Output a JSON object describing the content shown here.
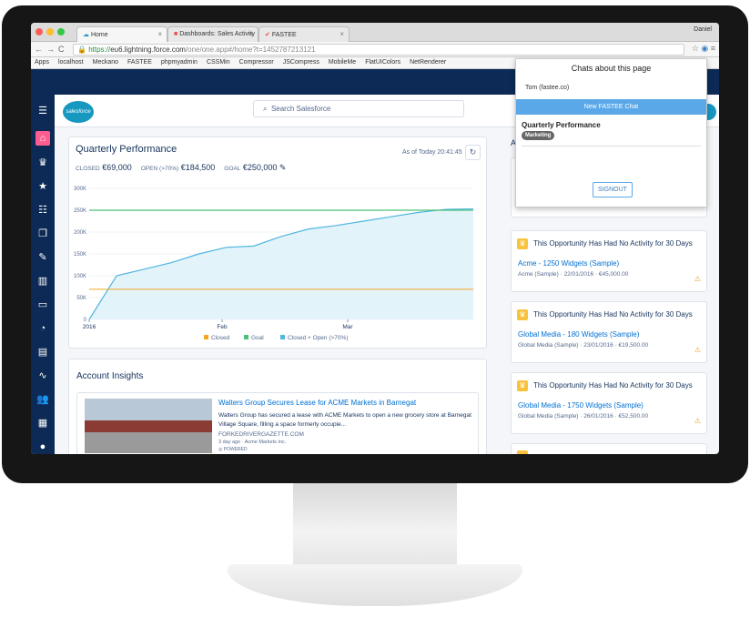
{
  "browser": {
    "tabs": [
      {
        "label": "Home"
      },
      {
        "label": "Dashboards: Sales Activity"
      },
      {
        "label": "FASTEE"
      }
    ],
    "user": "Daniel",
    "url_scheme": "https://",
    "url_host": "eu6.lightning.force.com",
    "url_rest": "/one/one.app#/home?t=1452787213121",
    "bookmarks": [
      "Apps",
      "localhost",
      "Meckano",
      "FASTEE",
      "phpmyadmin",
      "CSSMin",
      "Compressor",
      "JSCompress",
      "MobileMe",
      "FlatUIColors",
      "NetRenderer"
    ]
  },
  "header": {
    "logo": "salesforce",
    "search_placeholder": "Search Salesforce"
  },
  "performance": {
    "title": "Quarterly Performance",
    "as_of": "As of Today 20:41:45",
    "closed_label": "CLOSED",
    "closed_value": "€69,000",
    "open_label": "OPEN (>70%)",
    "open_value": "€184,500",
    "goal_label": "GOAL",
    "goal_value": "€250,000"
  },
  "chart_data": {
    "type": "line",
    "x_ticks": [
      "2016",
      "Feb",
      "Mar"
    ],
    "y_ticks": [
      "0",
      "50K",
      "100K",
      "150K",
      "200K",
      "250K",
      "300K"
    ],
    "ylim": [
      0,
      300000
    ],
    "legend": [
      "Closed",
      "Goal",
      "Closed + Open (>70%)"
    ],
    "series": [
      {
        "name": "Closed",
        "color": "#f5a623",
        "values": [
          69000,
          69000
        ]
      },
      {
        "name": "Goal",
        "color": "#4bc076",
        "values": [
          250000,
          250000
        ]
      },
      {
        "name": "Closed + Open (>70%)",
        "color": "#4fb6df",
        "values": [
          0,
          100000,
          115000,
          130000,
          150000,
          165000,
          168000,
          190000,
          207000,
          215000,
          225000,
          235000,
          245000,
          252000,
          253000
        ]
      }
    ]
  },
  "insights": {
    "title": "Account Insights",
    "article_title": "Walters Group Secures Lease for ACME Markets in Barnegat",
    "article_body": "Walters Group has secured a lease with ACME Markets to open a new grocery store at Barnegat Village Square, filling a space formerly occupie...",
    "source": "FORKEDRIVERGAZETTE.COM",
    "meta": "3 day ago · Acme Markets Inc.",
    "powered": "POWERED"
  },
  "opportunities": [
    {
      "header": "This Opportunity Has Had No Activity for 30 Days",
      "title": "Acme - 1250 Widgets (Sample)",
      "sub": "Acme (Sample) · 22/01/2016 · €45,000.00"
    },
    {
      "header": "This Opportunity Has Had No Activity for 30 Days",
      "title": "Global Media - 180 Widgets (Sample)",
      "sub": "Global Media (Sample) · 23/01/2016 · €19,500.00"
    },
    {
      "header": "This Opportunity Has Had No Activity for 30 Days",
      "title": "Global Media - 1750 Widgets (Sample)",
      "sub": "Global Media (Sample) · 26/01/2016 · €52,500.00"
    }
  ],
  "popup": {
    "title": "Chats about this page",
    "user": "Tom (fastee.co)",
    "new_chat": "New FASTEE Chat",
    "chat_title": "Quarterly Performance",
    "chat_tag": "Marketing",
    "signout": "SIGNOUT"
  }
}
